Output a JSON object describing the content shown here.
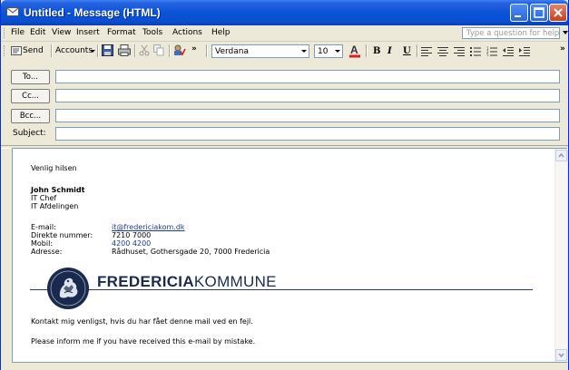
{
  "window": {
    "title": "Untitled - Message (HTML)"
  },
  "menu": [
    "File",
    "Edit",
    "View",
    "Insert",
    "Format",
    "Tools",
    "Actions",
    "Help"
  ],
  "help_search": {
    "placeholder": "Type a question for help"
  },
  "toolbar": {
    "send_label": "Send",
    "accounts_label": "Accounts",
    "font_name": "Verdana",
    "font_size": "10",
    "bold": "B",
    "italic": "I",
    "underline": "U",
    "overflow": "»"
  },
  "header": {
    "to_label": "To...",
    "cc_label": "Cc...",
    "bcc_label": "Bcc...",
    "subject_label": "Subject:",
    "to_value": "",
    "cc_value": "",
    "bcc_value": "",
    "subject_value": ""
  },
  "signature": {
    "greeting": "Venlig hilsen",
    "name": "John Schmidt",
    "title": "IT Chef",
    "department": "IT Afdelingen",
    "contacts": [
      {
        "label": "E-mail:",
        "value": "it@fredericiakom.dk",
        "style": "link"
      },
      {
        "label": "Direkte nummer:",
        "value": "7210 7000",
        "style": "plain"
      },
      {
        "label": "Mobil:",
        "value": "4200 4200",
        "style": "blue"
      },
      {
        "label": "Adresse:",
        "value": "Rådhuset, Gothersgade 20, 7000 Fredericia",
        "style": "plain"
      }
    ],
    "logo_bold": "FREDERICIA",
    "logo_light": "KOMMUNE",
    "disclaimer_da": "Kontakt mig venligst, hvis du har fået denne mail ved en fejl.",
    "disclaimer_en": "Please inform me if you have received this e-mail by mistake."
  },
  "colors": {
    "titlebar": "#0a53d7",
    "link": "#1a3c9a",
    "logo": "#1a2a4e"
  }
}
